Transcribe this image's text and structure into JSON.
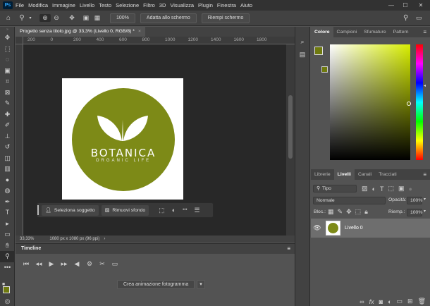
{
  "app": {
    "logo_text": "Ps"
  },
  "menu": [
    "File",
    "Modifica",
    "Immagine",
    "Livello",
    "Testo",
    "Selezione",
    "Filtro",
    "3D",
    "Visualizza",
    "Plugin",
    "Finestra",
    "Aiuto"
  ],
  "options_bar": {
    "zoom_value": "100%",
    "fit_screen_label": "Adatta allo schermo",
    "fill_screen_label": "Riempi schermo"
  },
  "document": {
    "tab_title": "Progetto senza titolo.jpg @ 33,3% (Livello 0, RGB/8) *",
    "tab_close": "×",
    "ruler_ticks": [
      "200",
      "0",
      "200",
      "400",
      "600",
      "800",
      "1000",
      "1200",
      "1400",
      "1600",
      "1800"
    ],
    "status_zoom": "33,33%",
    "status_size": "1080 px x 1080 px (96 ppi)"
  },
  "artwork": {
    "brand": "BOTANICA",
    "tagline": "ORGANIC LIFE",
    "circle_color": "#7d8a17",
    "bg_color": "#ffffff"
  },
  "context_bar": {
    "select_subject": "Seleziona soggetto",
    "remove_bg": "Rimuovi sfondo",
    "more": "•••"
  },
  "timeline": {
    "title": "Timeline",
    "create_anim": "Crea animazione fotogramma"
  },
  "color_panel": {
    "tabs": [
      "Colore",
      "Campioni",
      "Sfumature",
      "Pattern"
    ],
    "foreground": "#6f7a0f",
    "hue_color": "#d8ee00"
  },
  "layers_panel": {
    "tabs": [
      "Librerie",
      "Livelli",
      "Canali",
      "Tracciati"
    ],
    "filter_label": "Tipo",
    "blend_mode": "Normale",
    "opacity_label": "Opacità:",
    "opacity_value": "100%",
    "lock_label": "Bloc.:",
    "fill_label": "Riemp.:",
    "fill_value": "100%",
    "layer_name": "Livello 0",
    "footer_icons": [
      "link-icon",
      "fx",
      "mask-icon",
      "adjustment-icon",
      "folder-icon",
      "new-layer-icon",
      "trash-icon"
    ],
    "footer_fx": "fx"
  }
}
